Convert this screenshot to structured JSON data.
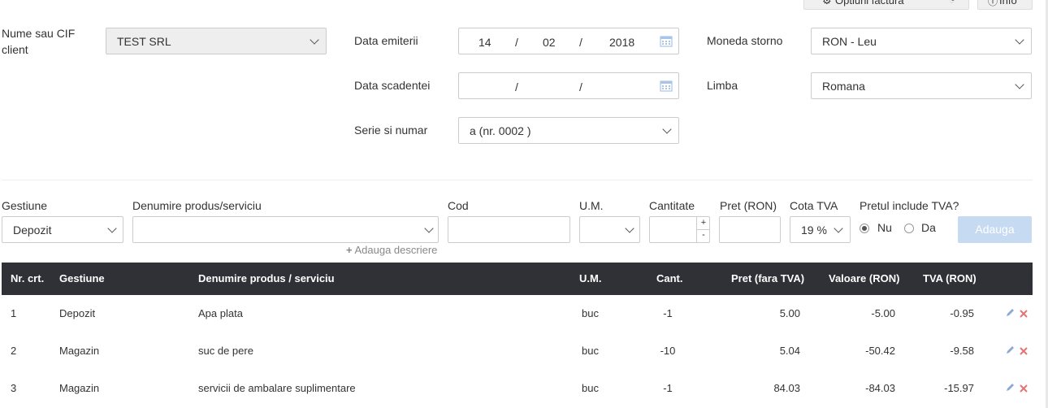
{
  "top_buttons": {
    "options_label": "Optiuni factura",
    "info_label": "Info"
  },
  "form": {
    "client_label": "Nume sau CIF client",
    "client_value": "TEST SRL",
    "issue_date_label": "Data emiterii",
    "issue_date": {
      "day": "14",
      "month": "02",
      "year": "2018",
      "sep": "/"
    },
    "due_date_label": "Data scadentei",
    "due_date": {
      "sep": "/"
    },
    "series_label": "Serie si numar",
    "series_value": "a (nr. 0002 )",
    "currency_label": "Moneda storno",
    "currency_value": "RON - Leu",
    "language_label": "Limba",
    "language_value": "Romana"
  },
  "add_row": {
    "gestiune_label": "Gestiune",
    "gestiune_value": "Depozit",
    "product_label": "Denumire produs/serviciu",
    "product_value": "",
    "cod_label": "Cod",
    "um_label": "U.M.",
    "qty_label": "Cantitate",
    "qty_plus": "+",
    "qty_minus": "-",
    "price_label": "Pret (RON)",
    "vat_label": "Cota TVA",
    "vat_value": "19 %",
    "vat_included_label": "Pretul include TVA?",
    "radio_no": "Nu",
    "radio_yes": "Da",
    "add_button": "Adauga",
    "add_description": "Adauga descriere"
  },
  "table": {
    "headers": {
      "nr": "Nr. crt.",
      "gestiune": "Gestiune",
      "product": "Denumire produs / serviciu",
      "um": "U.M.",
      "qty": "Cant.",
      "price": "Pret (fara TVA)",
      "value": "Valoare (RON)",
      "vat": "TVA (RON)"
    },
    "rows": [
      {
        "nr": "1",
        "gestiune": "Depozit",
        "product": "Apa plata",
        "um": "buc",
        "qty": "-1",
        "price": "5.00",
        "value": "-5.00",
        "vat": "-0.95"
      },
      {
        "nr": "2",
        "gestiune": "Magazin",
        "product": "suc de pere",
        "um": "buc",
        "qty": "-10",
        "price": "5.04",
        "value": "-50.42",
        "vat": "-9.58"
      },
      {
        "nr": "3",
        "gestiune": "Magazin",
        "product": "servicii de ambalare suplimentare",
        "um": "buc",
        "qty": "-1",
        "price": "84.03",
        "value": "-84.03",
        "vat": "-15.97"
      }
    ]
  },
  "icons": {
    "gear": "gear-icon",
    "info": "info-icon",
    "calendar": "calendar-icon",
    "plus": "plus-icon",
    "edit": "pencil-icon",
    "delete": "close-icon"
  },
  "colors": {
    "header_bg": "#2f3136",
    "edit_icon": "#8aa9d6",
    "delete_icon": "#e57373",
    "add_button_bg": "#c6daf2"
  }
}
